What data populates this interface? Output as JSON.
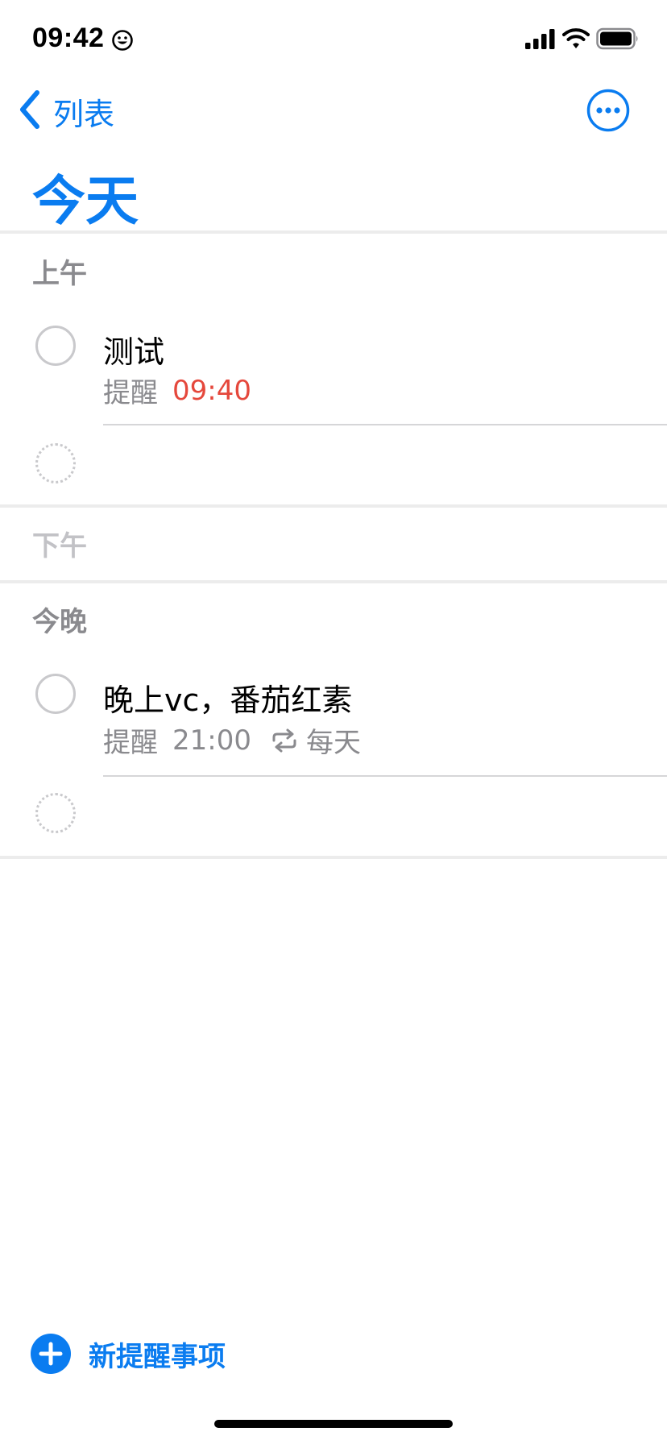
{
  "status_bar": {
    "time": "09:42",
    "icons": [
      "smiley-icon",
      "cellular-signal-icon",
      "wifi-icon",
      "battery-icon"
    ]
  },
  "nav": {
    "back_label": "列表",
    "back_icon": "chevron-left-icon",
    "more_icon": "ellipsis-circle-icon"
  },
  "page": {
    "title": "今天"
  },
  "sections": {
    "morning": {
      "header": "上午",
      "items": [
        {
          "title": "测试",
          "reminder_label": "提醒",
          "time": "09:40",
          "overdue": true
        }
      ]
    },
    "afternoon": {
      "header": "下午",
      "items": []
    },
    "tonight": {
      "header": "今晚",
      "items": [
        {
          "title": "晚上vc，番茄红素",
          "reminder_label": "提醒",
          "time": "21:00",
          "repeat_icon": "repeat-icon",
          "repeat_label": "每天"
        }
      ]
    }
  },
  "footer": {
    "new_reminder_label": "新提醒事项",
    "new_reminder_icon": "plus-circle-icon"
  },
  "colors": {
    "accent": "#0a7cf0",
    "overdue": "#e5483c",
    "secondary_text": "#8a8a8e",
    "empty_header": "#c2c2c6",
    "separator": "#ececec"
  }
}
